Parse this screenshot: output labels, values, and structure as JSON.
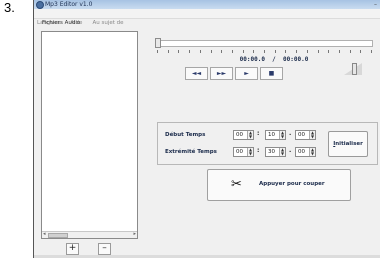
{
  "step_number": "3.",
  "window": {
    "title": "Mp3 Editor v1.0",
    "controls": "–"
  },
  "menu": [
    "Langues",
    "Aide",
    "Au sujet de"
  ],
  "files_panel": {
    "label": "Fichiers Audio",
    "add_label": "+",
    "remove_label": "–"
  },
  "player": {
    "time": "00:00.0  /  00:00.0",
    "buttons": {
      "rewind": "◄◄",
      "forward": "►►",
      "play": "►",
      "stop": "■"
    },
    "position": 0
  },
  "times": {
    "start_label": "Début Temps",
    "end_label": "Extrémité Temps",
    "start": [
      "00",
      "10",
      "00"
    ],
    "end": [
      "00",
      "30",
      "00"
    ],
    "sep_colon": ":",
    "sep_dot": "."
  },
  "reset_button": {
    "underlined": "I",
    "rest": "nitialiser"
  },
  "cut_button": {
    "label": "Appuyer pour couper"
  }
}
